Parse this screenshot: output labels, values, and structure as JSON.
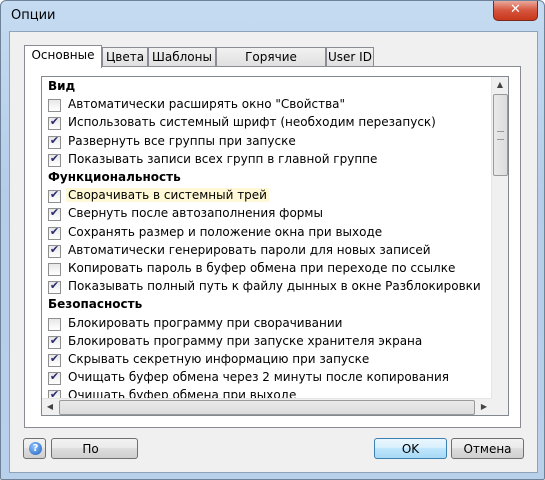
{
  "window": {
    "title": "Опции",
    "close_label": "✕"
  },
  "tabs": [
    {
      "label": "Основные",
      "active": true
    },
    {
      "label": "Цвета",
      "active": false
    },
    {
      "label": "Шаблоны",
      "active": false
    },
    {
      "label": "Горячие клавиши",
      "active": false
    },
    {
      "label": "User ID",
      "active": false
    }
  ],
  "options": [
    {
      "type": "header",
      "label": "Вид"
    },
    {
      "type": "item",
      "label": "Автоматически расширять окно \"Свойства\"",
      "checked": false
    },
    {
      "type": "item",
      "label": "Использовать системный шрифт (необходим перезапуск)",
      "checked": true
    },
    {
      "type": "item",
      "label": "Развернуть все группы при запуске",
      "checked": true
    },
    {
      "type": "item",
      "label": "Показывать записи всех групп в главной группе",
      "checked": true
    },
    {
      "type": "header",
      "label": "Функциональность"
    },
    {
      "type": "item",
      "label": "Сворачивать в системный трей",
      "checked": true,
      "highlighted": true
    },
    {
      "type": "item",
      "label": "Свернуть после автозаполнения формы",
      "checked": true
    },
    {
      "type": "item",
      "label": "Сохранять размер и положение окна при выходе",
      "checked": true
    },
    {
      "type": "item",
      "label": "Автоматически генерировать пароли для новых записей",
      "checked": true
    },
    {
      "type": "item",
      "label": "Копировать пароль в буфер обмена при переходе по ссылке",
      "checked": false
    },
    {
      "type": "item",
      "label": "Показывать полный путь к файлу дынных в окне Разблокировки",
      "checked": true
    },
    {
      "type": "header",
      "label": "Безопасность"
    },
    {
      "type": "item",
      "label": "Блокировать программу при сворачивании",
      "checked": false
    },
    {
      "type": "item",
      "label": "Блокировать программу при запуске хранителя экрана",
      "checked": true
    },
    {
      "type": "item",
      "label": "Скрывать секретную информацию при запуске",
      "checked": true
    },
    {
      "type": "item",
      "label": "Очищать буфер обмена через 2 минуты после копирования",
      "checked": true
    },
    {
      "type": "item",
      "label": "Очищать буфер обмена при выходе",
      "checked": true
    }
  ],
  "buttons": {
    "help_icon": "?",
    "defaults_label": "По умолчанию...",
    "ok_label": "OK",
    "cancel_label": "Отмена"
  },
  "icons": {
    "check": "✔",
    "scroll_up": "▲",
    "scroll_down": "▼",
    "scroll_left": "◀",
    "scroll_right": "▶"
  }
}
